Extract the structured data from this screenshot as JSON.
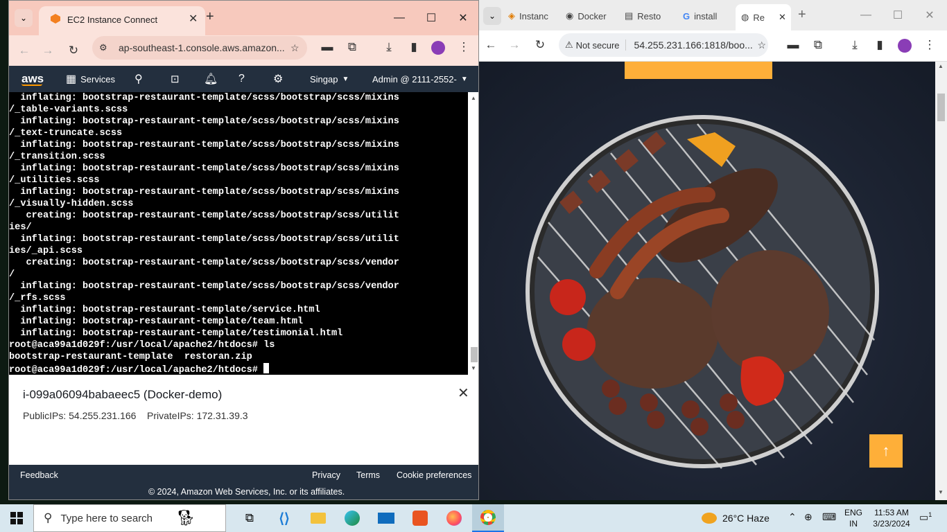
{
  "left_browser": {
    "tab_title": "EC2 Instance Connect",
    "url": "ap-southeast-1.console.aws.amazon....",
    "aws_nav": {
      "logo": "aws",
      "services": "Services",
      "region": "Singap",
      "account": "Admin @ 2111-2552-"
    },
    "terminal_lines": [
      "  inflating: bootstrap-restaurant-template/scss/bootstrap/scss/mixins",
      "/_table-variants.scss",
      "  inflating: bootstrap-restaurant-template/scss/bootstrap/scss/mixins",
      "/_text-truncate.scss",
      "  inflating: bootstrap-restaurant-template/scss/bootstrap/scss/mixins",
      "/_transition.scss",
      "  inflating: bootstrap-restaurant-template/scss/bootstrap/scss/mixins",
      "/_utilities.scss",
      "  inflating: bootstrap-restaurant-template/scss/bootstrap/scss/mixins",
      "/_visually-hidden.scss",
      "   creating: bootstrap-restaurant-template/scss/bootstrap/scss/utilit",
      "ies/",
      "  inflating: bootstrap-restaurant-template/scss/bootstrap/scss/utilit",
      "ies/_api.scss",
      "   creating: bootstrap-restaurant-template/scss/bootstrap/scss/vendor",
      "/",
      "  inflating: bootstrap-restaurant-template/scss/bootstrap/scss/vendor",
      "/_rfs.scss",
      "  inflating: bootstrap-restaurant-template/service.html",
      "  inflating: bootstrap-restaurant-template/team.html",
      "  inflating: bootstrap-restaurant-template/testimonial.html",
      "root@aca99a1d029f:/usr/local/apache2/htdocs# ls",
      "bootstrap-restaurant-template  restoran.zip"
    ],
    "prompt": "root@aca99a1d029f:/usr/local/apache2/htdocs# ",
    "instance": {
      "title": "i-099a06094babaeec5 (Docker-demo)",
      "public_ips": "PublicIPs: 54.255.231.166",
      "private_ips": "PrivateIPs: 172.31.39.3"
    },
    "footer": {
      "feedback": "Feedback",
      "privacy": "Privacy",
      "terms": "Terms",
      "cookies": "Cookie preferences",
      "copyright": "© 2024, Amazon Web Services, Inc. or its affiliates."
    }
  },
  "right_browser": {
    "tabs": [
      "Instanc",
      "Docker",
      "Resto",
      "install",
      "Re"
    ],
    "not_secure": "Not secure",
    "url": "54.255.231.166:1818/boo..."
  },
  "taskbar": {
    "search_placeholder": "Type here to search",
    "weather": "26°C  Haze",
    "lang_top": "ENG",
    "lang_bottom": "IN",
    "time": "11:53 AM",
    "date": "3/23/2024",
    "notifications": "1"
  },
  "colors": {
    "aws_dark": "#232f3e",
    "tab_peach": "#f7c9bd",
    "book_orange": "#feaf39",
    "scroll_top_orange": "#feaf39"
  }
}
